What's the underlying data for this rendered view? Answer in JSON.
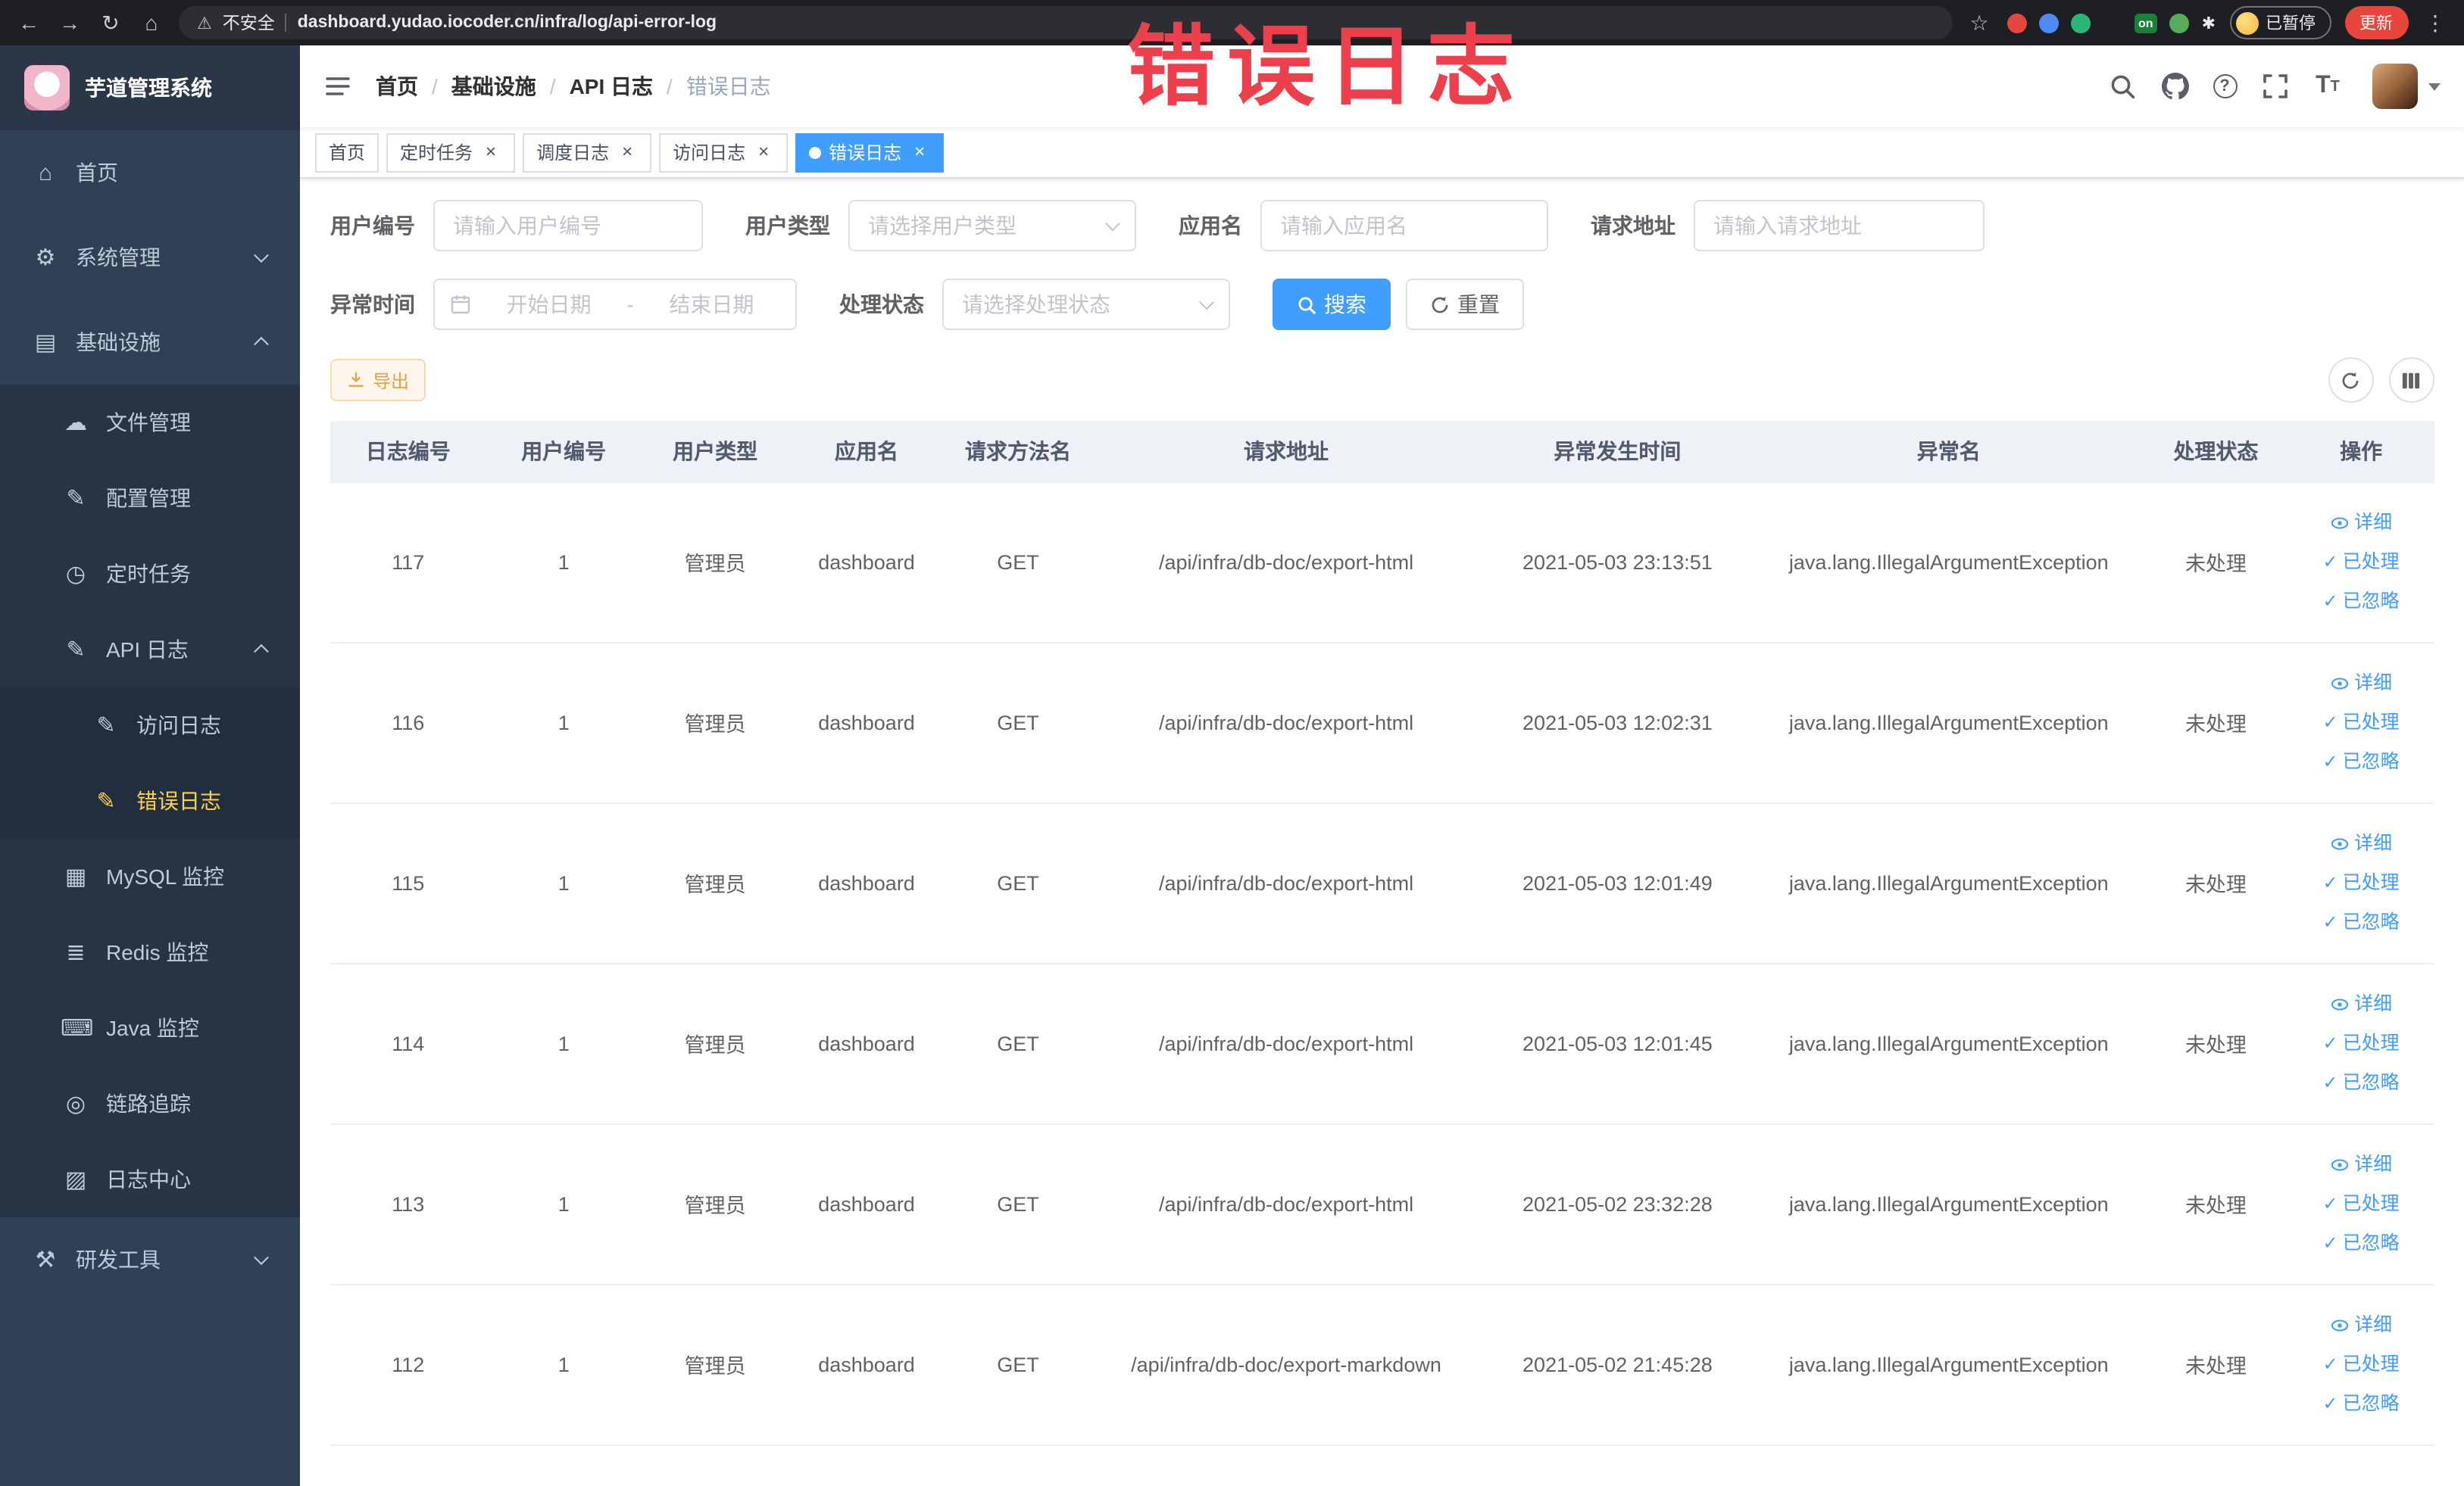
{
  "colors": {
    "accent": "#409eff",
    "sidebar_active": "#ffd04b",
    "warning": "#e6a23c",
    "annotation": "#ee3f4d"
  },
  "annotation": {
    "text": "错误日志"
  },
  "browser": {
    "security_label": "不安全",
    "url": "dashboard.yudao.iocoder.cn/infra/log/api-error-log",
    "ext_on_badge": "on",
    "profile_paused_label": "已暂停",
    "update_label": "更新"
  },
  "sidebar": {
    "app_title": "芋道管理系统",
    "items": [
      {
        "id": "home",
        "label": "首页",
        "icon": "home-icon",
        "indent": 1
      },
      {
        "id": "system-manage",
        "label": "系统管理",
        "icon": "gear-icon",
        "indent": 1,
        "chevron": "down"
      },
      {
        "id": "infrastructure",
        "label": "基础设施",
        "icon": "infra-icon",
        "indent": 1,
        "chevron": "up"
      },
      {
        "id": "file-manage",
        "label": "文件管理",
        "icon": "cloud-icon",
        "indent": 2
      },
      {
        "id": "config-manage",
        "label": "配置管理",
        "icon": "pencil-icon",
        "indent": 2
      },
      {
        "id": "scheduled-job",
        "label": "定时任务",
        "icon": "clock-icon",
        "indent": 2
      },
      {
        "id": "api-log",
        "label": "API 日志",
        "icon": "compose-icon",
        "indent": 2,
        "chevron": "up"
      },
      {
        "id": "access-log",
        "label": "访问日志",
        "icon": "compose-icon",
        "indent": 3
      },
      {
        "id": "error-log",
        "label": "错误日志",
        "icon": "compose-icon",
        "indent": 3,
        "active": true
      },
      {
        "id": "mysql-monitor",
        "label": "MySQL 监控",
        "icon": "mysql-icon",
        "indent": 2
      },
      {
        "id": "redis-monitor",
        "label": "Redis 监控",
        "icon": "redis-icon",
        "indent": 2
      },
      {
        "id": "java-monitor",
        "label": "Java 监控",
        "icon": "java-icon",
        "indent": 2
      },
      {
        "id": "link-trace",
        "label": "链路追踪",
        "icon": "trace-icon",
        "indent": 2
      },
      {
        "id": "log-center",
        "label": "日志中心",
        "icon": "log-center-icon",
        "indent": 2
      },
      {
        "id": "dev-tools",
        "label": "研发工具",
        "icon": "tools-icon",
        "indent": 1,
        "chevron": "down"
      }
    ]
  },
  "breadcrumb": [
    "首页",
    "基础设施",
    "API 日志",
    "错误日志"
  ],
  "tags": [
    {
      "id": "home",
      "label": "首页",
      "active": false,
      "closable": false
    },
    {
      "id": "job",
      "label": "定时任务",
      "active": false,
      "closable": true
    },
    {
      "id": "job-log",
      "label": "调度日志",
      "active": false,
      "closable": true
    },
    {
      "id": "access-log",
      "label": "访问日志",
      "active": false,
      "closable": true
    },
    {
      "id": "error-log",
      "label": "错误日志",
      "active": true,
      "closable": true
    }
  ],
  "filters": {
    "user_id": {
      "label": "用户编号",
      "placeholder": "请输入用户编号"
    },
    "user_type": {
      "label": "用户类型",
      "placeholder": "请选择用户类型"
    },
    "app_name": {
      "label": "应用名",
      "placeholder": "请输入应用名"
    },
    "request_url": {
      "label": "请求地址",
      "placeholder": "请输入请求地址"
    },
    "exception_time": {
      "label": "异常时间",
      "start_placeholder": "开始日期",
      "separator": "-",
      "end_placeholder": "结束日期"
    },
    "process_status": {
      "label": "处理状态",
      "placeholder": "请选择处理状态"
    },
    "search_label": "搜索",
    "reset_label": "重置"
  },
  "toolbar": {
    "export_label": "导出"
  },
  "table": {
    "columns": [
      "日志编号",
      "用户编号",
      "用户类型",
      "应用名",
      "请求方法名",
      "请求地址",
      "异常发生时间",
      "异常名",
      "处理状态",
      "操作"
    ],
    "row_actions": [
      {
        "id": "detail",
        "label": "详细",
        "icon": "eye-icon"
      },
      {
        "id": "processed",
        "label": "已处理",
        "icon": "check-icon"
      },
      {
        "id": "ignored",
        "label": "已忽略",
        "icon": "check-icon"
      }
    ],
    "rows": [
      {
        "id": "117",
        "user_id": "1",
        "user_type": "管理员",
        "app_name": "dashboard",
        "method": "GET",
        "url": "/api/infra/db-doc/export-html",
        "time": "2021-05-03 23:13:51",
        "exception": "java.lang.IllegalArgumentException",
        "status": "未处理"
      },
      {
        "id": "116",
        "user_id": "1",
        "user_type": "管理员",
        "app_name": "dashboard",
        "method": "GET",
        "url": "/api/infra/db-doc/export-html",
        "time": "2021-05-03 12:02:31",
        "exception": "java.lang.IllegalArgumentException",
        "status": "未处理"
      },
      {
        "id": "115",
        "user_id": "1",
        "user_type": "管理员",
        "app_name": "dashboard",
        "method": "GET",
        "url": "/api/infra/db-doc/export-html",
        "time": "2021-05-03 12:01:49",
        "exception": "java.lang.IllegalArgumentException",
        "status": "未处理"
      },
      {
        "id": "114",
        "user_id": "1",
        "user_type": "管理员",
        "app_name": "dashboard",
        "method": "GET",
        "url": "/api/infra/db-doc/export-html",
        "time": "2021-05-03 12:01:45",
        "exception": "java.lang.IllegalArgumentException",
        "status": "未处理"
      },
      {
        "id": "113",
        "user_id": "1",
        "user_type": "管理员",
        "app_name": "dashboard",
        "method": "GET",
        "url": "/api/infra/db-doc/export-html",
        "time": "2021-05-02 23:32:28",
        "exception": "java.lang.IllegalArgumentException",
        "status": "未处理"
      },
      {
        "id": "112",
        "user_id": "1",
        "user_type": "管理员",
        "app_name": "dashboard",
        "method": "GET",
        "url": "/api/infra/db-doc/export-markdown",
        "time": "2021-05-02 21:45:28",
        "exception": "java.lang.IllegalArgumentException",
        "status": "未处理"
      }
    ]
  }
}
